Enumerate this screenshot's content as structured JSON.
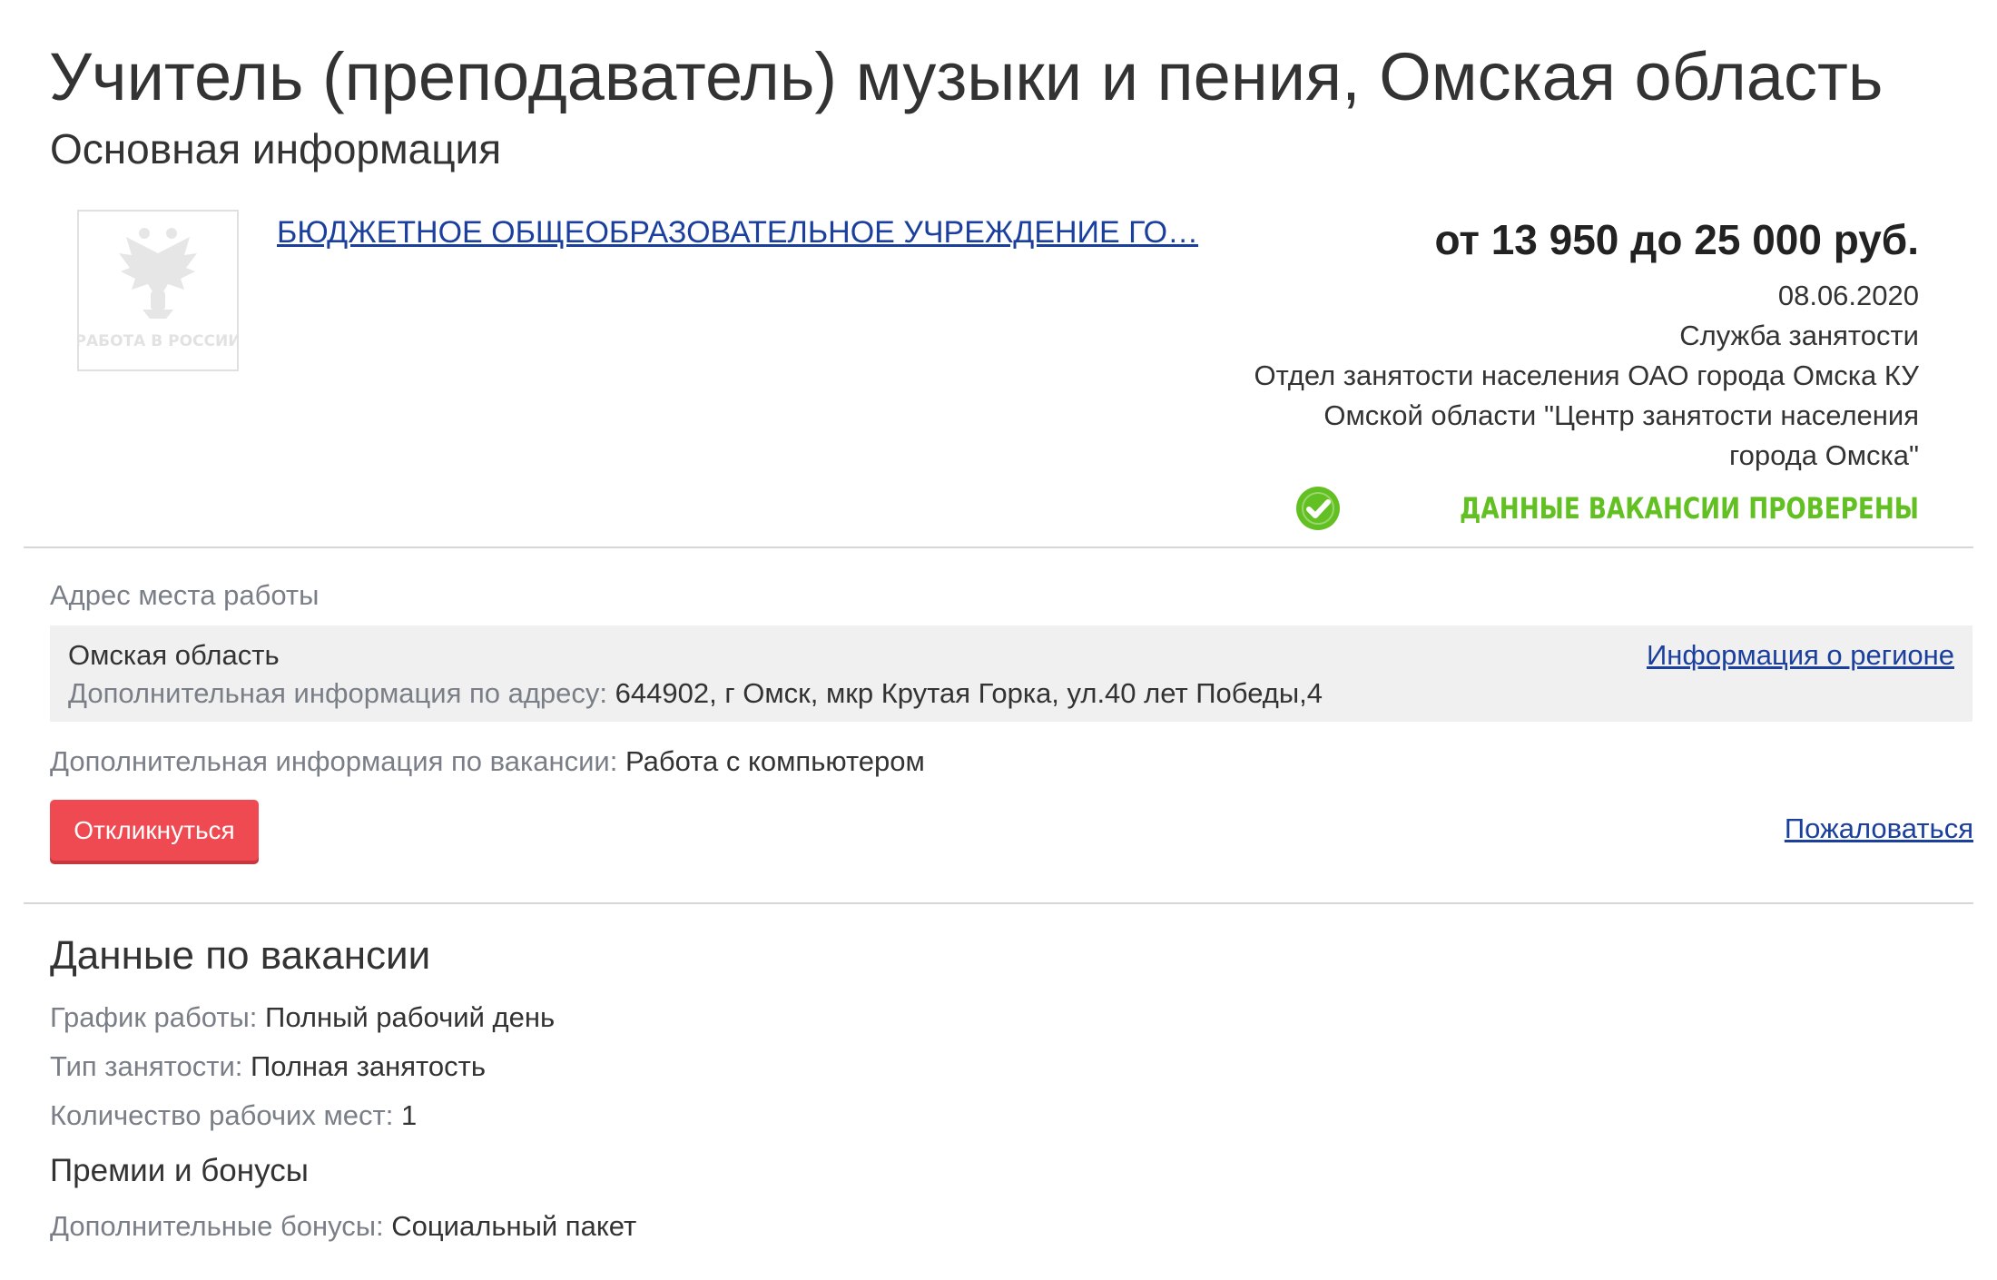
{
  "header": {
    "title": "Учитель (преподаватель) музыки и пения, Омская область",
    "section_title": "Основная информация"
  },
  "employer": {
    "logo_icon": "work-in-russia-emblem-icon",
    "logo_text": "РАБОТА В РОССИИ",
    "name": "БЮДЖЕТНОЕ ОБЩЕОБРАЗОВАТЕЛЬНОЕ УЧРЕЖДЕНИЕ ГО…"
  },
  "summary": {
    "salary": "от 13 950 до 25 000 руб.",
    "date": "08.06.2020",
    "source_type": "Служба занятости",
    "source_org": "Отдел занятости населения ОАО города Омска КУ Омской области \"Центр занятости населения города Омска\"",
    "verified_icon": "check-circle-icon",
    "verified_text": "ДАННЫЕ ВАКАНСИИ ПРОВЕРЕНЫ",
    "verified_color": "#63c022"
  },
  "address": {
    "label": "Адрес места работы",
    "region": "Омская область",
    "extra_label": "Дополнительная информация по адресу:",
    "extra_value": "644902, г Омск, мкр Крутая Горка, ул.40 лет Победы,4",
    "region_link": "Информация о регионе"
  },
  "vacancy_extra": {
    "label": "Дополнительная информация по вакансии:",
    "value": "Работа с компьютером"
  },
  "actions": {
    "respond_label": "Откликнуться",
    "respond_color": "#ef4a52",
    "complain_label": "Пожаловаться"
  },
  "details": {
    "title": "Данные по вакансии",
    "schedule_label": "График работы:",
    "schedule_value": "Полный рабочий день",
    "employment_label": "Тип занятости:",
    "employment_value": "Полная занятость",
    "positions_label": "Количество рабочих мест:",
    "positions_value": "1"
  },
  "bonuses": {
    "title": "Премии и бонусы",
    "extra_label": "Дополнительные бонусы:",
    "extra_value": "Социальный пакет"
  },
  "colors": {
    "link": "#1a3f9d",
    "muted_label": "#7a7f87",
    "text": "#333333"
  }
}
